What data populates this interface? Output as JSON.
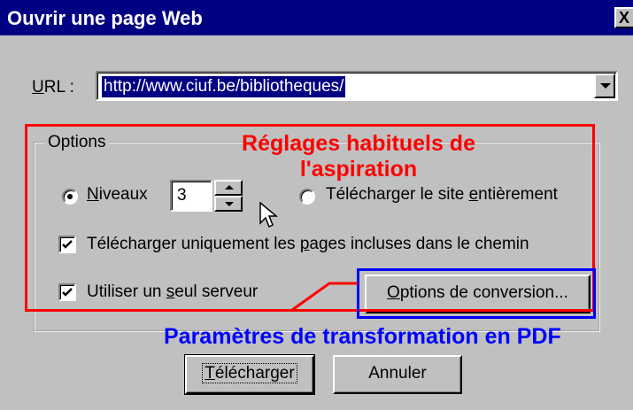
{
  "window": {
    "title": "Ouvrir une page Web",
    "close_glyph": "X"
  },
  "url": {
    "label_first": "U",
    "label_rest": "RL :",
    "value": "http://www.ciuf.be/bibliotheques/"
  },
  "options": {
    "group_title": "Options",
    "levels_radio": {
      "label_first": "N",
      "label_rest": "iveaux",
      "selected": true
    },
    "levels_value": "3",
    "full_site_radio": {
      "label_before": "Télécharger le site ",
      "label_underlined": "e",
      "label_after": "ntièrement",
      "selected": false
    },
    "path_only_checkbox": {
      "label_before": "Télécharger uniquement les ",
      "label_underlined": "p",
      "label_after": "ages incluses dans le chemin",
      "checked": true
    },
    "single_server_checkbox": {
      "label_before": "Utiliser un ",
      "label_underlined": "s",
      "label_after": "eul serveur",
      "checked": true
    },
    "conversion_button": {
      "label_first": "O",
      "label_rest": "ptions de conversion..."
    }
  },
  "buttons": {
    "download": {
      "label_first": "T",
      "label_rest": "élécharger"
    },
    "cancel": {
      "label": "Annuler"
    }
  },
  "annotations": {
    "red_line1": "Réglages habituels de",
    "red_line2": "l'aspiration",
    "blue": "Paramètres de transformation en PDF",
    "red_color": "#ff0000",
    "blue_color": "#0000ff"
  },
  "colors": {
    "titlebar": "#000082",
    "dialog_face": "#c0c0c0"
  }
}
